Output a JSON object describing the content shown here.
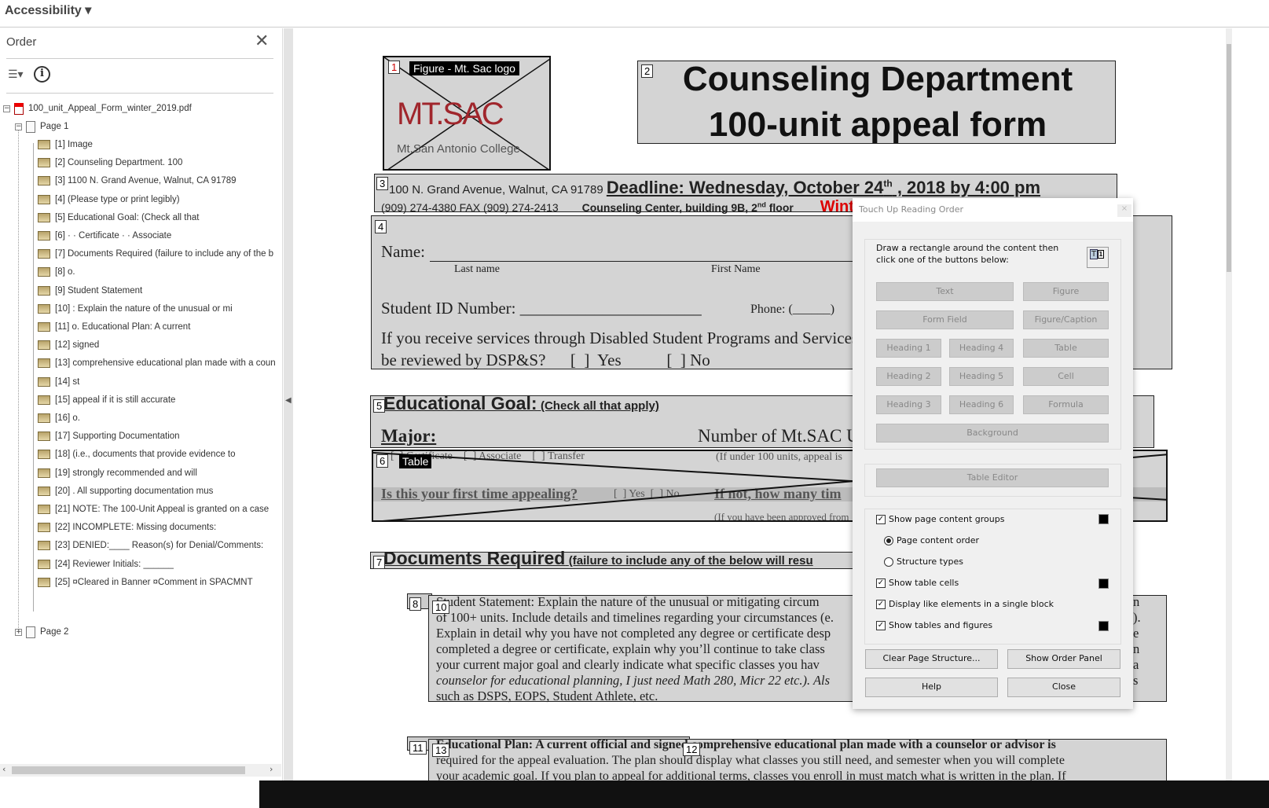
{
  "topbar": {
    "title": "Accessibility"
  },
  "panel": {
    "title": "Order",
    "tree": {
      "file": "100_unit_Appeal_Form_winter_2019.pdf",
      "page1": "Page 1",
      "page2": "Page 2",
      "items": [
        "[1]  Image",
        "[2]  Counseling Department. 100",
        "[3]  1100 N. Grand Avenue, Walnut, CA 91789",
        "[4]  (Please type or print legibly)",
        "[5]  Educational Goal: (Check all that",
        "[6]  · · Certificate · · Associate",
        "[7]  Documents Required (failure to include any of the b",
        "[8]  o.",
        "[9]  Student Statement",
        "[10]  : Explain the nature of the unusual or mi",
        "[11]  o. Educational Plan: A current",
        "[12]  signed",
        "[13]  comprehensive educational plan made with a coun",
        "[14]  st",
        "[15]  appeal if it is still accurate",
        "[16]  o.",
        "[17]  Supporting Documentation",
        "[18]  (i.e., documents that provide evidence to",
        "[19]  strongly recommended and will",
        "[20]  . All supporting documentation mus",
        "[21]  NOTE: The 100-Unit Appeal is granted on a case",
        "[22]  INCOMPLETE: Missing documents:",
        "[23]  DENIED:____ Reason(s) for Denial/Comments:",
        "[24]  Reviewer Initials: ______",
        "[25]  ¤Cleared in Banner ¤Comment in SPACMNT"
      ]
    }
  },
  "doc": {
    "fig_label": "Figure - Mt. Sac logo",
    "logo_main": "MT.SAC",
    "logo_sub": "Mt.San Antonio College",
    "title1": "Counseling Department",
    "title2": "100-unit appeal form",
    "address": "100 N. Grand Avenue, Walnut, CA  91789",
    "deadline_pre": "Deadline: Wednesday, October 24",
    "deadline_sup": "th",
    "deadline_post": " , 2018 by 4:00 pm",
    "phone": "(909) 274-4380 FAX (909) 274-2413",
    "center_pre": "Counseling Center, building 9B, 2",
    "center_sup": "nd",
    "center_post": " floor",
    "red_text": "Winter Term 2019 Only",
    "name": "Name:",
    "last": "Last name",
    "first": "First Name",
    "sid": "Student ID Number: ______________________",
    "phone_field": "Phone: (______)",
    "dsps1": "If you receive services through Disabled Student Programs and Services",
    "dsps2": "be reviewed by DSP&S?      [  ]  Yes           [  ] No",
    "goal": "Educational Goal:",
    "goal_sub": "(Check all that apply)",
    "major": "Major:",
    "number_of": "Number of Mt.SAC U",
    "table_label": "Table",
    "row1": "[  ] Certificate    [  ] Associate    [  ] Transfer",
    "row1b": "(If under 100 units, appeal is",
    "first_time": "Is this your first time appealing?",
    "yesno": "[  ] Yes  [  ] No",
    "if_not": "If not, how many tim",
    "approved": "(If you have been approved from",
    "docs": "Documents Required",
    "docs_sub": "(failure to include any of the below will resu",
    "stmt": [
      "Student Statement: Explain the nature of the unusual or mitigating circum",
      "of 100+ units.  Include details and timelines regarding your circumstances (e.",
      "Explain in detail why you have not completed any degree or certificate desp",
      "completed a degree or certificate, explain why you’ll continue to take class",
      "your current major goal and clearly indicate what specific classes you hav",
      "counselor for educational planning, I just need Math 280, Micr 22 etc.). Als",
      "such as DSPS, EOPS, Student Athlete, etc."
    ],
    "stmt_right": [
      "n",
      ").",
      "e",
      "n",
      "a",
      "s"
    ],
    "plan": [
      "Educational Plan:  A current official and signed comprehensive educational plan made with a counselor or advisor is",
      "required for the appeal evaluation.  The plan should display what classes you still need, and semester when you will complete",
      "your academic goal.  If you plan to appeal for additional terms, classes you enroll in must match what is written in the plan.  If"
    ],
    "nums": [
      "1",
      "2",
      "3",
      "4",
      "5",
      "6",
      "7",
      "8",
      "10",
      "11",
      "13",
      "12"
    ]
  },
  "dialog": {
    "title": "Touch Up Reading Order",
    "instructions": "Draw a rectangle around the content then click one of the buttons below:",
    "buttons": {
      "text": "Text",
      "figure": "Figure",
      "form_field": "Form Field",
      "figure_caption": "Figure/Caption",
      "h1": "Heading 1",
      "h4": "Heading 4",
      "table": "Table",
      "h2": "Heading 2",
      "h5": "Heading 5",
      "cell": "Cell",
      "h3": "Heading 3",
      "h6": "Heading 6",
      "formula": "Formula",
      "background": "Background",
      "table_editor": "Table Editor"
    },
    "options": {
      "show_groups": "Show page content groups",
      "content_order": "Page content order",
      "structure_types": "Structure types",
      "table_cells": "Show table cells",
      "like_elements": "Display like elements in a single block",
      "tables_figures": "Show tables and figures"
    },
    "clear": "Clear Page Structure...",
    "show_order": "Show Order Panel",
    "help": "Help",
    "close": "Close",
    "swatch_color": "#000000"
  }
}
